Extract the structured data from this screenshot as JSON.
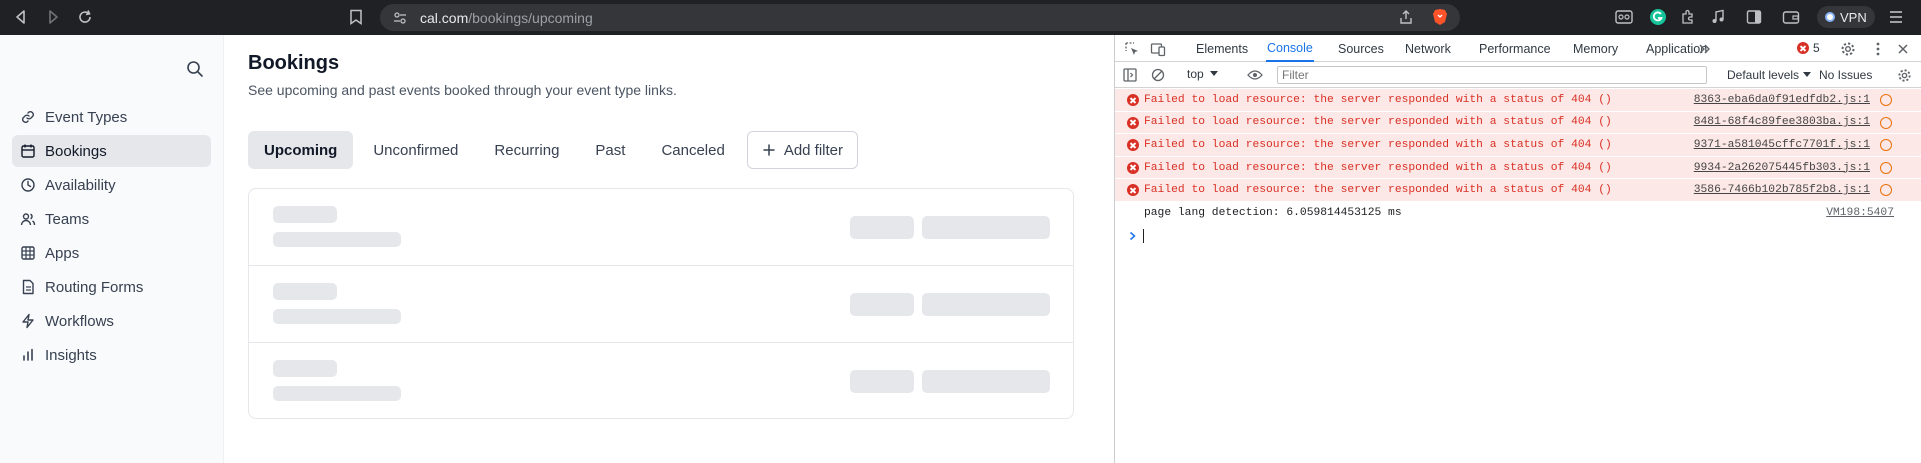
{
  "browser": {
    "url_host": "cal.com",
    "url_path": "/bookings/upcoming",
    "vpn_label": "VPN"
  },
  "sidebar": {
    "items": [
      {
        "label": "Event Types",
        "icon": "link-icon"
      },
      {
        "label": "Bookings",
        "icon": "calendar-icon",
        "active": true
      },
      {
        "label": "Availability",
        "icon": "clock-icon"
      },
      {
        "label": "Teams",
        "icon": "users-icon"
      },
      {
        "label": "Apps",
        "icon": "grid-icon"
      },
      {
        "label": "Routing Forms",
        "icon": "file-icon"
      },
      {
        "label": "Workflows",
        "icon": "zap-icon"
      },
      {
        "label": "Insights",
        "icon": "bar-chart-icon"
      }
    ]
  },
  "main": {
    "title": "Bookings",
    "subtitle": "See upcoming and past events booked through your event type links.",
    "tabs": [
      {
        "label": "Upcoming",
        "active": true
      },
      {
        "label": "Unconfirmed"
      },
      {
        "label": "Recurring"
      },
      {
        "label": "Past"
      },
      {
        "label": "Canceled"
      }
    ],
    "add_filter_label": "Add filter"
  },
  "devtools": {
    "tabs": [
      "Elements",
      "Console",
      "Sources",
      "Network",
      "Performance",
      "Memory",
      "Application"
    ],
    "active_tab": "Console",
    "error_count": "5",
    "context": "top",
    "filter_placeholder": "Filter",
    "levels_label": "Default levels",
    "issues_label": "No Issues",
    "messages": [
      {
        "level": "error",
        "text": "Failed to load resource: the server responded with a status of 404 ()",
        "source": "8363-eba6da0f91edfdb2.js:1"
      },
      {
        "level": "error",
        "text": "Failed to load resource: the server responded with a status of 404 ()",
        "source": "8481-68f4c89fee3803ba.js:1"
      },
      {
        "level": "error",
        "text": "Failed to load resource: the server responded with a status of 404 ()",
        "source": "9371-a581045cffc7701f.js:1"
      },
      {
        "level": "error",
        "text": "Failed to load resource: the server responded with a status of 404 ()",
        "source": "9934-2a262075445fb303.js:1"
      },
      {
        "level": "error",
        "text": "Failed to load resource: the server responded with a status of 404 ()",
        "source": "3586-7466b102b785f2b8.js:1"
      },
      {
        "level": "log",
        "text": "page lang detection: 6.059814453125 ms",
        "source": "VM198:5407"
      }
    ]
  },
  "colors": {
    "chrome_bg": "#202124",
    "accent_blue": "#1a73e8",
    "error_red": "#d93025",
    "error_bg": "#fce8e6"
  }
}
